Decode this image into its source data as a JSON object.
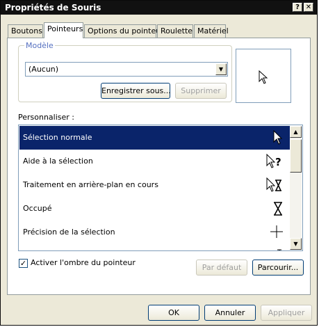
{
  "window": {
    "title": "Propriétés de Souris",
    "help_glyph": "?",
    "close_glyph": "✕"
  },
  "tabs": [
    {
      "label": "Boutons"
    },
    {
      "label": "Pointeurs",
      "active": true
    },
    {
      "label": "Options du pointeur"
    },
    {
      "label": "Roulette"
    },
    {
      "label": "Matériel"
    }
  ],
  "scheme": {
    "group_label": "Modèle",
    "selected_value": "(Aucun)",
    "save_as_label": "Enregistrer sous...",
    "delete_label": "Supprimer"
  },
  "customize": {
    "label": "Personnaliser :",
    "items": [
      {
        "label": "Sélection normale",
        "icon": "arrow-cursor-icon",
        "selected": true
      },
      {
        "label": "Aide à la sélection",
        "icon": "help-cursor-icon"
      },
      {
        "label": "Traitement en arrière-plan en cours",
        "icon": "working-in-background-cursor-icon"
      },
      {
        "label": "Occupé",
        "icon": "hourglass-icon"
      },
      {
        "label": "Précision de la sélection",
        "icon": "crosshair-icon"
      },
      {
        "label": "",
        "icon": "text-cursor-icon"
      }
    ]
  },
  "shadow": {
    "label": "Activer l'ombre du pointeur",
    "checked": true
  },
  "buttons": {
    "default_label": "Par défaut",
    "browse_label": "Parcourir...",
    "ok_label": "OK",
    "cancel_label": "Annuler",
    "apply_label": "Appliquer"
  },
  "colors": {
    "selection": "#0a246a",
    "titlebar": "#111111",
    "dialog_bg": "#ece9d8"
  }
}
